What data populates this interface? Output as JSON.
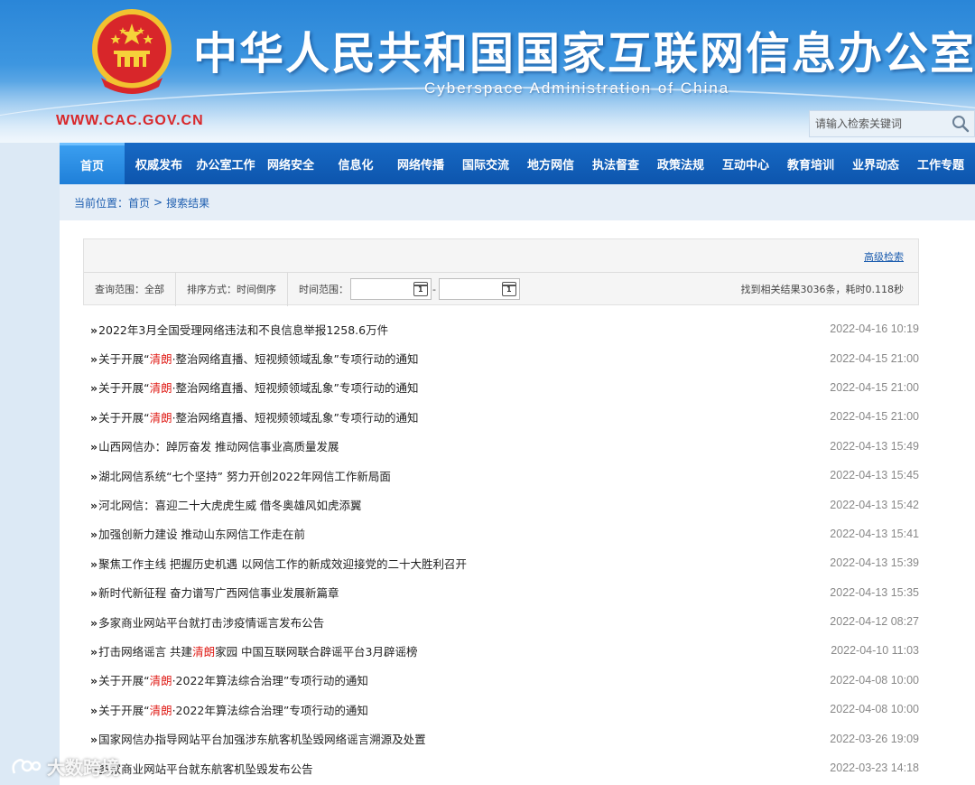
{
  "header": {
    "title": "中华人民共和国国家互联网信息办公室",
    "subtitle": "Cyberspace Administration of China",
    "url": "WWW.CAC.GOV.CN",
    "search_placeholder": "请输入检索关键词"
  },
  "nav": {
    "items": [
      "首页",
      "权威发布",
      "办公室工作",
      "网络安全",
      "信息化",
      "网络传播",
      "国际交流",
      "地方网信",
      "执法督查",
      "政策法规",
      "互动中心",
      "教育培训",
      "业界动态",
      "工作专题"
    ],
    "active_index": 0
  },
  "breadcrumb": {
    "prefix": "当前位置：",
    "home": "首页",
    "separator": ">",
    "current": "搜索结果"
  },
  "filter": {
    "advanced_search": "高级检索",
    "scope": "查询范围：全部",
    "sort": "排序方式：时间倒序",
    "time_range_label": "时间范围：",
    "date_separator": "-",
    "calendar_day": "1",
    "summary": "找到相关结果3036条，耗时0.118秒"
  },
  "results": [
    {
      "prefix": "»",
      "before": "2022年3月全国受理网络违法和不良信息举报1258.6万件",
      "highlight": "",
      "after": "",
      "date": "2022-04-16 10:19"
    },
    {
      "prefix": "»",
      "before": "关于开展“",
      "highlight": "清朗",
      "after": "·整治网络直播、短视频领域乱象”专项行动的通知",
      "date": "2022-04-15 21:00"
    },
    {
      "prefix": "»",
      "before": "关于开展“",
      "highlight": "清朗",
      "after": "·整治网络直播、短视频领域乱象”专项行动的通知",
      "date": "2022-04-15 21:00"
    },
    {
      "prefix": "»",
      "before": "关于开展“",
      "highlight": "清朗",
      "after": "·整治网络直播、短视频领域乱象”专项行动的通知",
      "date": "2022-04-15 21:00"
    },
    {
      "prefix": "»",
      "before": "山西网信办：踔厉奋发 推动网信事业高质量发展",
      "highlight": "",
      "after": "",
      "date": "2022-04-13 15:49"
    },
    {
      "prefix": "»",
      "before": "湖北网信系统“七个坚持” 努力开创2022年网信工作新局面",
      "highlight": "",
      "after": "",
      "date": "2022-04-13 15:45"
    },
    {
      "prefix": "»",
      "before": "河北网信：喜迎二十大虎虎生威 借冬奥雄风如虎添翼",
      "highlight": "",
      "after": "",
      "date": "2022-04-13 15:42"
    },
    {
      "prefix": "»",
      "before": "加强创新力建设 推动山东网信工作走在前",
      "highlight": "",
      "after": "",
      "date": "2022-04-13 15:41"
    },
    {
      "prefix": "»",
      "before": "聚焦工作主线 把握历史机遇 以网信工作的新成效迎接党的二十大胜利召开",
      "highlight": "",
      "after": "",
      "date": "2022-04-13 15:39"
    },
    {
      "prefix": "»",
      "before": "新时代新征程 奋力谱写广西网信事业发展新篇章",
      "highlight": "",
      "after": "",
      "date": "2022-04-13 15:35"
    },
    {
      "prefix": "»",
      "before": "多家商业网站平台就打击涉疫情谣言发布公告",
      "highlight": "",
      "after": "",
      "date": "2022-04-12 08:27"
    },
    {
      "prefix": "»",
      "before": "打击网络谣言 共建",
      "highlight": "清朗",
      "after": "家园 中国互联网联合辟谣平台3月辟谣榜",
      "date": "2022-04-10 11:03"
    },
    {
      "prefix": "»",
      "before": "关于开展“",
      "highlight": "清朗",
      "after": "·2022年算法综合治理”专项行动的通知",
      "date": "2022-04-08 10:00"
    },
    {
      "prefix": "»",
      "before": "关于开展“",
      "highlight": "清朗",
      "after": "·2022年算法综合治理”专项行动的通知",
      "date": "2022-04-08 10:00"
    },
    {
      "prefix": "»",
      "before": "国家网信办指导网站平台加强涉东航客机坠毁网络谣言溯源及处置",
      "highlight": "",
      "after": "",
      "date": "2022-03-26 19:09"
    },
    {
      "prefix": "»",
      "before": "多家商业网站平台就东航客机坠毁发布公告",
      "highlight": "",
      "after": "",
      "date": "2022-03-23 14:18"
    }
  ],
  "watermark": "大数跨境"
}
